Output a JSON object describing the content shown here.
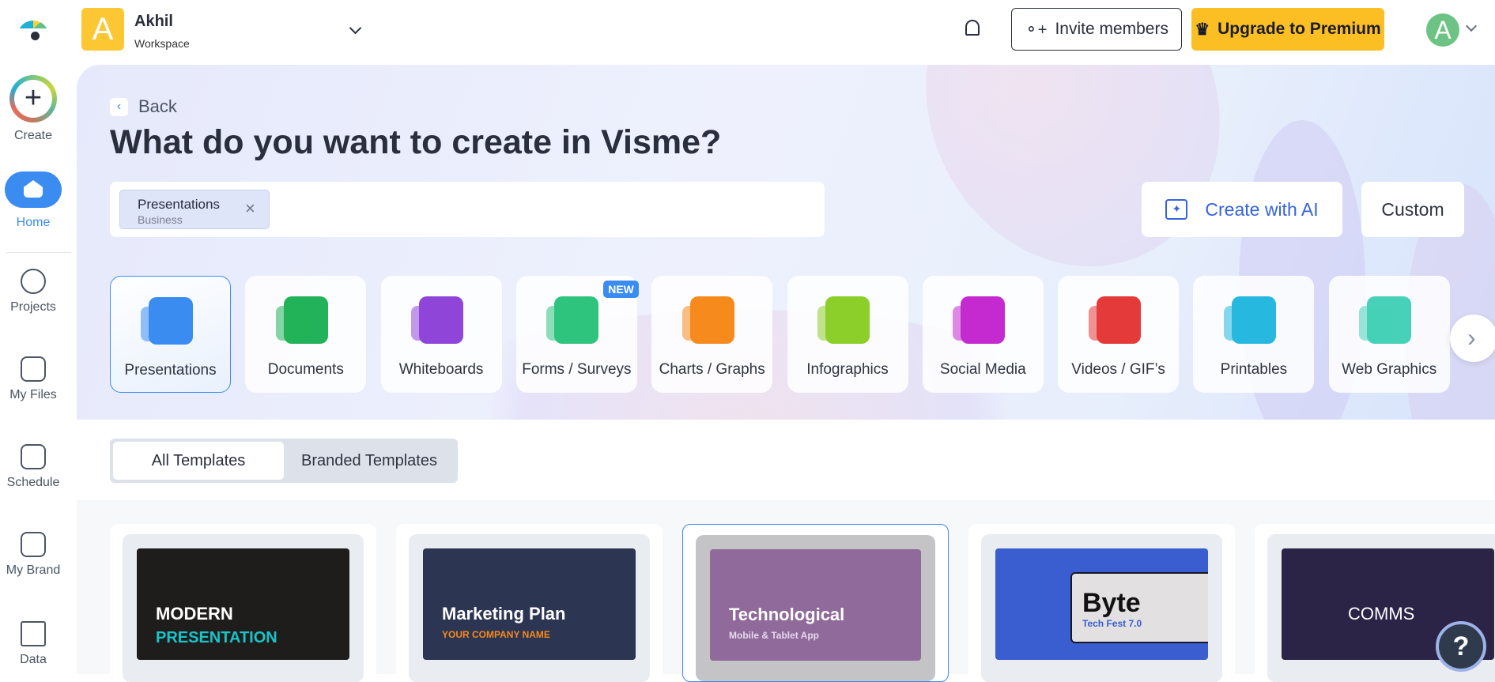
{
  "workspace": {
    "initial": "A",
    "name": "Akhil",
    "subtitle": "Workspace"
  },
  "sidebar": {
    "items": [
      {
        "label": "Create"
      },
      {
        "label": "Home"
      },
      {
        "label": "Projects"
      },
      {
        "label": "My Files"
      },
      {
        "label": "Schedule"
      },
      {
        "label": "My Brand"
      },
      {
        "label": "Data"
      }
    ]
  },
  "header": {
    "invite_label": "Invite members",
    "upgrade_label": "Upgrade to Premium",
    "avatar_initial": "A"
  },
  "hero": {
    "back_label": "Back",
    "title": "What do you want to create in Visme?",
    "chip": {
      "label": "Presentations",
      "sub": "Business"
    },
    "create_ai_label": "Create with AI",
    "custom_label": "Custom"
  },
  "categories": [
    {
      "label": "Presentations",
      "color": "#3b8cf0"
    },
    {
      "label": "Documents",
      "color": "#22b35a"
    },
    {
      "label": "Whiteboards",
      "color": "#8f45d8"
    },
    {
      "label": "Forms / Surveys",
      "color": "#2fc47d",
      "badge": "NEW"
    },
    {
      "label": "Charts / Graphs",
      "color": "#f78a1d"
    },
    {
      "label": "Infographics",
      "color": "#8ccf2a"
    },
    {
      "label": "Social Media",
      "color": "#c52ad1"
    },
    {
      "label": "Videos / GIF’s",
      "color": "#e53a3a"
    },
    {
      "label": "Printables",
      "color": "#27b8df"
    },
    {
      "label": "Web Graphics",
      "color": "#46d1b8"
    }
  ],
  "tabs": {
    "all": "All Templates",
    "branded": "Branded Templates"
  },
  "templates": [
    {
      "title": "MODERN",
      "subtitle": "PRESENTATION",
      "bg": "#1f1d1c"
    },
    {
      "title": "Marketing Plan",
      "subtitle": "YOUR COMPANY NAME",
      "bg": "#2c3552"
    },
    {
      "title": "Technological",
      "subtitle": "Mobile & Tablet App",
      "bg": "#8f6a9a"
    },
    {
      "title": "Byte",
      "subtitle": "Tech Fest 7.0",
      "bg": "#3a5ed0"
    },
    {
      "title": "COMMS",
      "subtitle": "",
      "bg": "#2b2447"
    }
  ],
  "help": {
    "label": "?"
  }
}
